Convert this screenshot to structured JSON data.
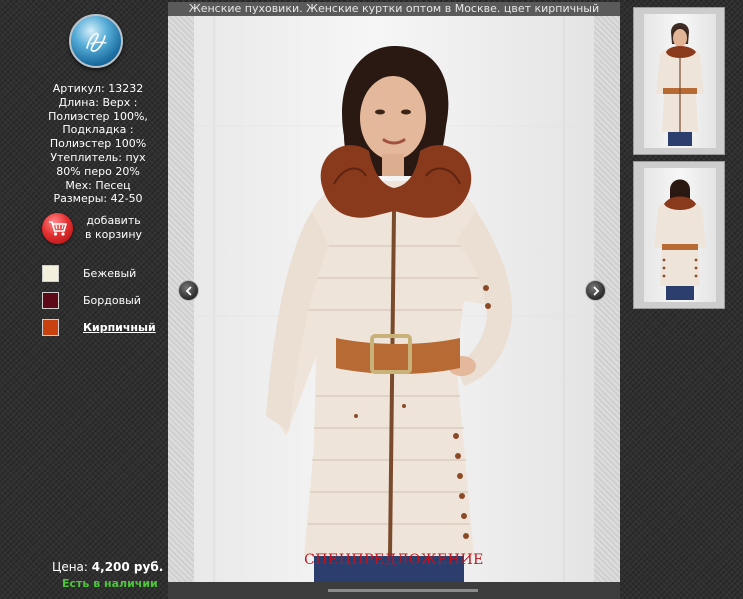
{
  "page_title": "Женские пуховики. Женские куртки оптом в Москве. цвет кирпичный",
  "logo": {
    "icon": "signature-logo-icon"
  },
  "specs": {
    "line1": "Артикул: 13232",
    "line2": "Длина: Верх :",
    "line3": "Полиэстер 100%,",
    "line4": "Подкладка :",
    "line5": "Полиэстер 100%",
    "line6": "Утеплитель: пух",
    "line7": "80% перо 20%",
    "line8": "Мех: Песец",
    "line9": "Размеры: 42-50"
  },
  "cart": {
    "line1": "добавить",
    "line2": "в корзину",
    "icon": "shopping-cart-icon"
  },
  "colors": [
    {
      "label": "Бежевый",
      "hex": "#f3f1dd",
      "active": false
    },
    {
      "label": "Бордовый",
      "hex": "#5c0a18",
      "active": false
    },
    {
      "label": "Кирпичный",
      "hex": "#c9410f",
      "active": true
    }
  ],
  "price": {
    "label": "Цена:",
    "value": "4,200 руб."
  },
  "stock": "Есть в наличии",
  "viewer": {
    "promo": "СПЕЦПРЕДЛОЖЕНИЕ",
    "prev_icon": "chevron-left-icon",
    "next_icon": "chevron-right-icon"
  },
  "thumbnails": [
    {
      "view": "front"
    },
    {
      "view": "back"
    }
  ],
  "accent_colors": {
    "fur": "#8a3a1c",
    "belt": "#b86a35",
    "coat": "#eee2d6",
    "stock_green": "#4ec43d",
    "promo_red": "#c0121c"
  }
}
